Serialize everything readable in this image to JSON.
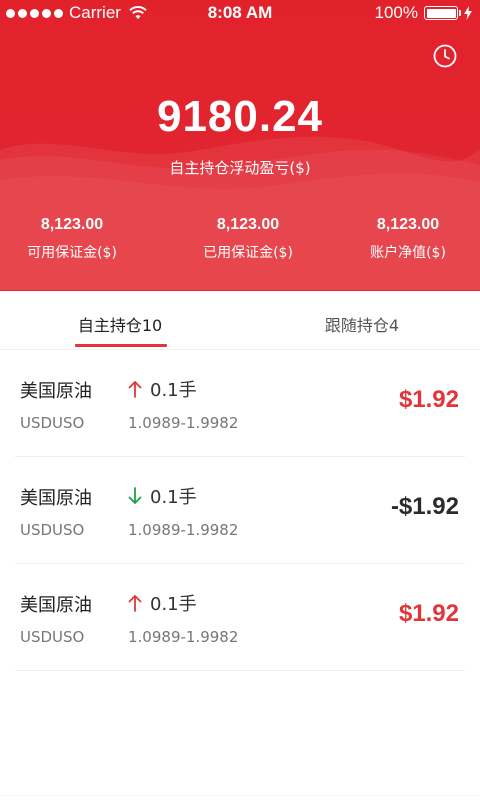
{
  "status_bar": {
    "carrier": "Carrier",
    "time": "8:08 AM",
    "battery": "100%",
    "battery_level": 1.0
  },
  "header": {
    "total_value": "9180.24",
    "total_label": "自主持仓浮动盈亏($)",
    "history_icon": "clock-icon",
    "stats": [
      {
        "value": "8,123.00",
        "label": "可用保证金($)"
      },
      {
        "value": "8,123.00",
        "label": "已用保证金($)"
      },
      {
        "value": "8,123.00",
        "label": "账户净值($)"
      }
    ]
  },
  "tabs": [
    {
      "label": "自主持仓10",
      "active": true
    },
    {
      "label": "跟随持仓4",
      "active": false
    }
  ],
  "positions": [
    {
      "name": "美国原油",
      "direction": "up",
      "lots": "0.1手",
      "code": "USDUSO",
      "range": "1.0989-1.9982",
      "pnl": "$1.92"
    },
    {
      "name": "美国原油",
      "direction": "down",
      "lots": "0.1手",
      "code": "USDUSO",
      "range": "1.0989-1.9982",
      "pnl": "-$1.92"
    },
    {
      "name": "美国原油",
      "direction": "up",
      "lots": "0.1手",
      "code": "USDUSO",
      "range": "1.0989-1.9982",
      "pnl": "$1.92"
    }
  ],
  "colors": {
    "header_red": "#e2222b",
    "accent_red": "#e33539",
    "down_green": "#1aa34a",
    "negative_text": "#2b2b2b"
  }
}
